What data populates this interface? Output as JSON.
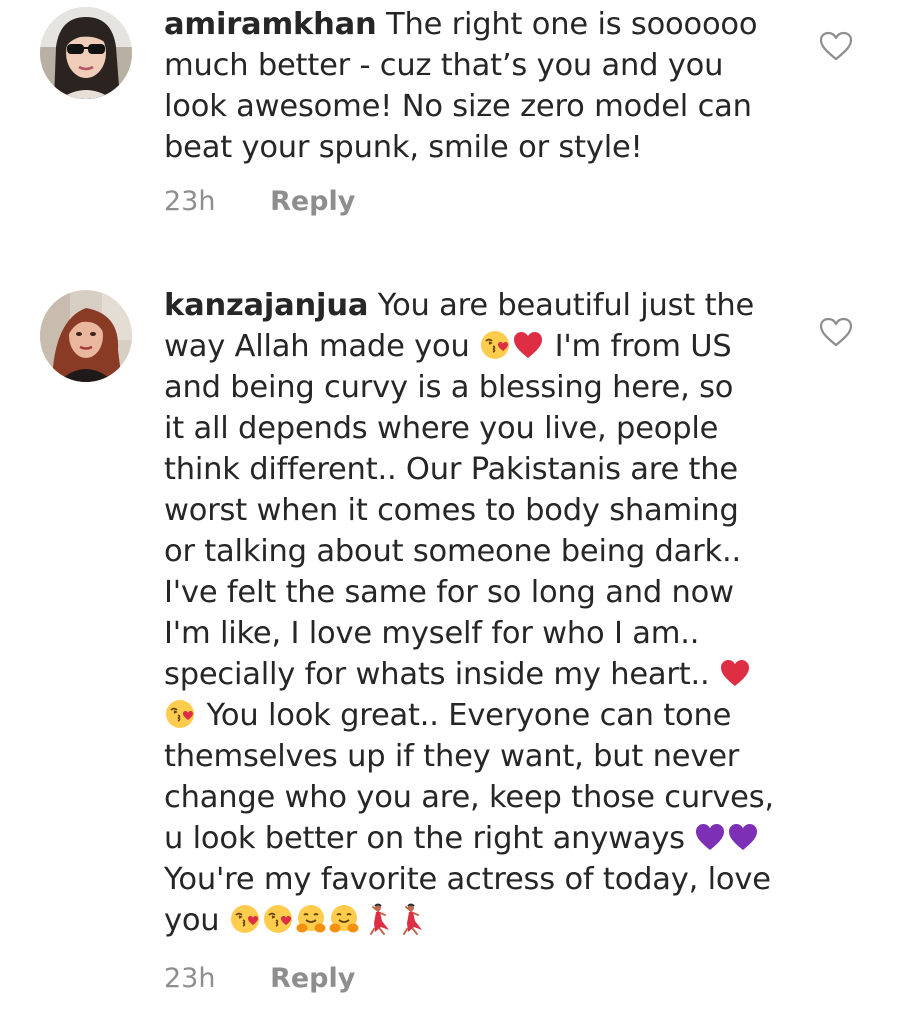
{
  "comments": [
    {
      "username": "amiramkhan",
      "segments": [
        {
          "t": "text",
          "v": " The right one is soooooo\nmuch better - cuz that’s you and you\nlook awesome! No size zero model can\nbeat your spunk, smile or style!"
        }
      ],
      "time": "23h",
      "reply_label": "Reply"
    },
    {
      "username": "kanzajanjua",
      "segments": [
        {
          "t": "text",
          "v": " You are beautiful just the\nway Allah made you "
        },
        {
          "t": "emoji",
          "v": "kissing-heart"
        },
        {
          "t": "emoji",
          "v": "red-heart"
        },
        {
          "t": "text",
          "v": " I'm from US\nand being curvy is a blessing here, so\nit all depends where you live, people\nthink different.. Our Pakistanis are the\nworst when it comes to body shaming\nor talking about someone being dark..\nI've felt the same for so long and now\nI'm like, I love myself for who I am..\nspecially for whats inside my heart.. "
        },
        {
          "t": "emoji",
          "v": "red-heart"
        },
        {
          "t": "text",
          "v": "\n"
        },
        {
          "t": "emoji",
          "v": "kissing-heart"
        },
        {
          "t": "text",
          "v": " You look great.. Everyone can tone\nthemselves up if they want, but never\nchange who you are, keep those curves,\nu look better on the right anyways "
        },
        {
          "t": "emoji",
          "v": "purple-heart"
        },
        {
          "t": "emoji",
          "v": "purple-heart"
        },
        {
          "t": "text",
          "v": "\nYou're my favorite actress of today, love\nyou "
        },
        {
          "t": "emoji",
          "v": "kissing-heart"
        },
        {
          "t": "emoji",
          "v": "kissing-heart"
        },
        {
          "t": "emoji",
          "v": "hugging-face"
        },
        {
          "t": "emoji",
          "v": "hugging-face"
        },
        {
          "t": "emoji",
          "v": "dancing-woman"
        },
        {
          "t": "emoji",
          "v": "dancing-woman"
        }
      ],
      "time": "23h",
      "reply_label": "Reply"
    }
  ],
  "icons": {
    "like": "heart-outline-icon"
  },
  "colors": {
    "text": "#262626",
    "meta": "#8e8e8e",
    "heart_red": "#dd2e44",
    "heart_purple": "#7d2fb5"
  }
}
